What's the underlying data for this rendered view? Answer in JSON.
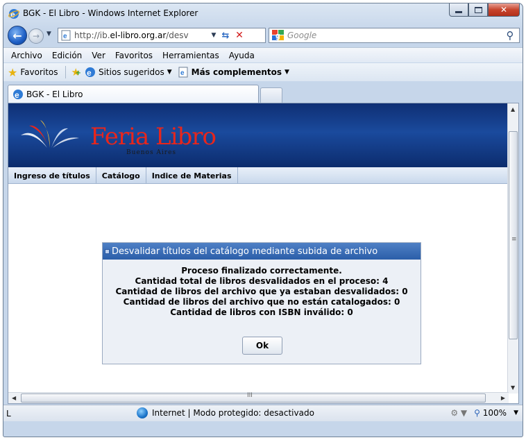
{
  "window": {
    "title": "BGK - El Libro - Windows Internet Explorer"
  },
  "nav": {
    "url_prefix": "http://ib.",
    "url_domain": "el-libro.org.ar",
    "url_suffix": "/desv",
    "search_placeholder": "Google"
  },
  "menu": {
    "items": [
      "Archivo",
      "Edición",
      "Ver",
      "Favoritos",
      "Herramientas",
      "Ayuda"
    ]
  },
  "favorites_bar": {
    "favorites_label": "Favoritos",
    "suggested_label": "Sitios sugeridos",
    "addons_label": "Más complementos"
  },
  "tab": {
    "title": "BGK - El Libro"
  },
  "site": {
    "logo_title": "Feria Libro",
    "logo_sub": "Buenos Aires",
    "nav_items": [
      "Ingreso de títulos",
      "Catálogo",
      "Indice de Materias"
    ]
  },
  "dialog": {
    "title": "Desvalidar títulos del catálogo mediante subida de archivo",
    "lines": [
      "Proceso finalizado correctamente.",
      "Cantidad total de libros desvalidados en el proceso: 4",
      "Cantidad de libros del archivo que ya estaban desvalidados: 0",
      "Cantidad de libros del archivo que no están catalogados: 0",
      "Cantidad de libros con ISBN inválido: 0"
    ],
    "ok_label": "Ok"
  },
  "statusbar": {
    "left_text": "L",
    "zone_text": "Internet | Modo protegido: desactivado",
    "zoom": "100%"
  },
  "colors": {
    "header_blue": "#1a4a9d",
    "logo_red": "#e8261c",
    "dialog_title_blue": "#2b5ea9"
  },
  "icons": [
    "ie-icon",
    "back-arrow-icon",
    "forward-arrow-icon",
    "refresh-icon",
    "stop-icon",
    "google-icon",
    "search-icon",
    "star-icon",
    "add-favorite-icon",
    "globe-icon",
    "protected-mode-icon",
    "zoom-icon"
  ]
}
